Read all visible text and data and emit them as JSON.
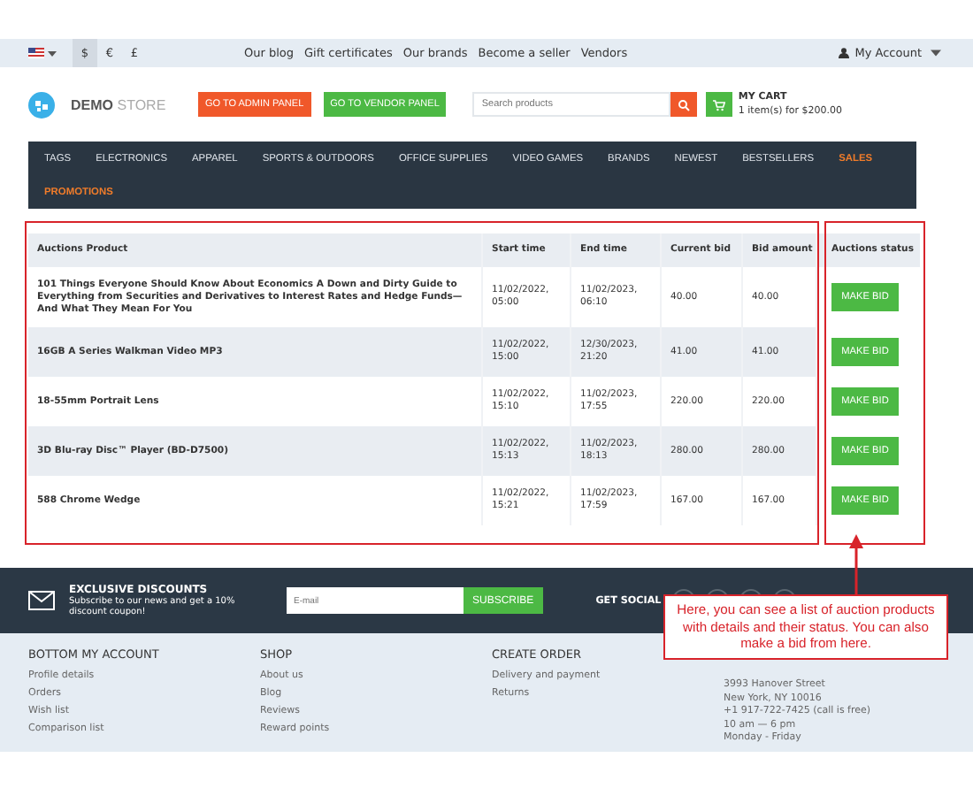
{
  "top_bar": {
    "currencies": [
      {
        "label": "$",
        "selected": true
      },
      {
        "label": "€",
        "selected": false
      },
      {
        "label": "£",
        "selected": false
      }
    ],
    "links": [
      "Our blog",
      "Gift certificates",
      "Our brands",
      "Become a seller",
      "Vendors"
    ],
    "account": "My Account"
  },
  "header": {
    "logo": {
      "bold": "DEMO",
      "light": "STORE"
    },
    "buttons": [
      {
        "label": "GO TO ADMIN PANEL",
        "color": "#f0582a"
      },
      {
        "label": "GO TO VENDOR PANEL",
        "color": "#4cb944"
      }
    ],
    "search": {
      "placeholder": "Search products"
    },
    "cart": {
      "title": "MY CART",
      "summary": "1 item(s) for $200.00"
    }
  },
  "nav": [
    {
      "label": "TAGS",
      "highlighted": false
    },
    {
      "label": "ELECTRONICS",
      "highlighted": false
    },
    {
      "label": "APPAREL",
      "highlighted": false
    },
    {
      "label": "SPORTS & OUTDOORS",
      "highlighted": false
    },
    {
      "label": "OFFICE SUPPLIES",
      "highlighted": false
    },
    {
      "label": "VIDEO GAMES",
      "highlighted": false
    },
    {
      "label": "BRANDS",
      "highlighted": false
    },
    {
      "label": "NEWEST",
      "highlighted": false
    },
    {
      "label": "BESTSELLERS",
      "highlighted": false
    },
    {
      "label": "SALES",
      "highlighted": true
    },
    {
      "label": "PROMOTIONS",
      "highlighted": true
    }
  ],
  "table": {
    "columns": [
      "Auctions Product",
      "Start time",
      "End time",
      "Current bid",
      "Bid amount",
      "Auctions status"
    ],
    "rows": [
      {
        "product": "101 Things Everyone Should Know About Economics A Down and Dirty Guide to Everything from Securities and Derivatives to Interest Rates and Hedge Funds—And What They Mean For You",
        "start_time": "11/02/2022, 05:00",
        "end_time": "11/02/2023, 06:10",
        "current_bid": "40.00",
        "bid_amount": "40.00",
        "action": "MAKE BID"
      },
      {
        "product": "16GB A Series Walkman Video MP3",
        "start_time": "11/02/2022, 15:00",
        "end_time": "12/30/2023, 21:20",
        "current_bid": "41.00",
        "bid_amount": "41.00",
        "action": "MAKE BID"
      },
      {
        "product": "18-55mm Portrait Lens",
        "start_time": "11/02/2022, 15:10",
        "end_time": "11/02/2023, 17:55",
        "current_bid": "220.00",
        "bid_amount": "220.00",
        "action": "MAKE BID"
      },
      {
        "product": "3D Blu-ray Disc™ Player (BD-D7500)",
        "start_time": "11/02/2022, 15:13",
        "end_time": "11/02/2023, 18:13",
        "current_bid": "280.00",
        "bid_amount": "280.00",
        "action": "MAKE BID"
      },
      {
        "product": "588 Chrome Wedge",
        "start_time": "11/02/2022, 15:21",
        "end_time": "11/02/2023, 17:59",
        "current_bid": "167.00",
        "bid_amount": "167.00",
        "action": "MAKE BID"
      }
    ]
  },
  "newsletter": {
    "title": "EXCLUSIVE DISCOUNTS",
    "text": "Subscribe to our news and get a 10% discount coupon!",
    "email": {
      "placeholder": "E-mail"
    },
    "button": "SUBSCRIBE",
    "social": "GET SOCIAL"
  },
  "footer": {
    "columns": [
      {
        "title": "BOTTOM MY ACCOUNT",
        "items": [
          "Profile details",
          "Orders",
          "Wish list",
          "Comparison list"
        ]
      },
      {
        "title": "SHOP",
        "items": [
          "About us",
          "Blog",
          "Reviews",
          "Reward points"
        ]
      },
      {
        "title": "CREATE ORDER",
        "items": [
          "Delivery and payment",
          "Returns"
        ]
      }
    ],
    "contacts": [
      "3993 Hanover Street",
      "New York, NY 10016",
      "+1 917-722-7425 (call is free)",
      "10 am — 6 pm",
      "Monday - Friday"
    ]
  },
  "annotation": {
    "text": "Here, you can see a list of auction products with details and their status. You can also make a bid from here."
  }
}
